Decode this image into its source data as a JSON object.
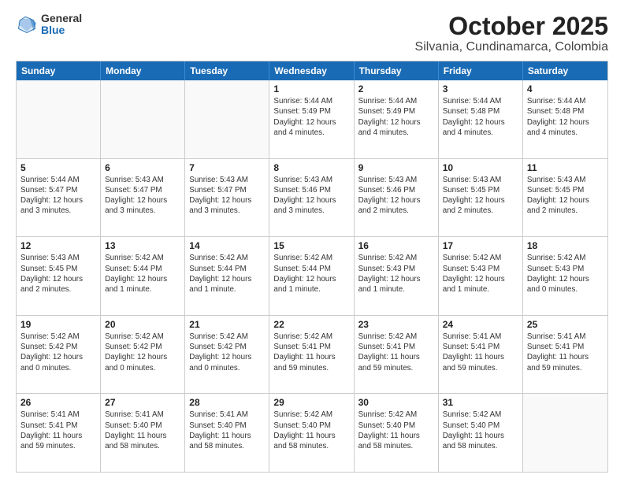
{
  "logo": {
    "general": "General",
    "blue": "Blue"
  },
  "title": "October 2025",
  "subtitle": "Silvania, Cundinamarca, Colombia",
  "days": [
    "Sunday",
    "Monday",
    "Tuesday",
    "Wednesday",
    "Thursday",
    "Friday",
    "Saturday"
  ],
  "weeks": [
    [
      {
        "day": "",
        "text": "",
        "empty": true
      },
      {
        "day": "",
        "text": "",
        "empty": true
      },
      {
        "day": "",
        "text": "",
        "empty": true
      },
      {
        "day": "1",
        "text": "Sunrise: 5:44 AM\nSunset: 5:49 PM\nDaylight: 12 hours\nand 4 minutes.",
        "empty": false
      },
      {
        "day": "2",
        "text": "Sunrise: 5:44 AM\nSunset: 5:49 PM\nDaylight: 12 hours\nand 4 minutes.",
        "empty": false
      },
      {
        "day": "3",
        "text": "Sunrise: 5:44 AM\nSunset: 5:48 PM\nDaylight: 12 hours\nand 4 minutes.",
        "empty": false
      },
      {
        "day": "4",
        "text": "Sunrise: 5:44 AM\nSunset: 5:48 PM\nDaylight: 12 hours\nand 4 minutes.",
        "empty": false
      }
    ],
    [
      {
        "day": "5",
        "text": "Sunrise: 5:44 AM\nSunset: 5:47 PM\nDaylight: 12 hours\nand 3 minutes.",
        "empty": false
      },
      {
        "day": "6",
        "text": "Sunrise: 5:43 AM\nSunset: 5:47 PM\nDaylight: 12 hours\nand 3 minutes.",
        "empty": false
      },
      {
        "day": "7",
        "text": "Sunrise: 5:43 AM\nSunset: 5:47 PM\nDaylight: 12 hours\nand 3 minutes.",
        "empty": false
      },
      {
        "day": "8",
        "text": "Sunrise: 5:43 AM\nSunset: 5:46 PM\nDaylight: 12 hours\nand 3 minutes.",
        "empty": false
      },
      {
        "day": "9",
        "text": "Sunrise: 5:43 AM\nSunset: 5:46 PM\nDaylight: 12 hours\nand 2 minutes.",
        "empty": false
      },
      {
        "day": "10",
        "text": "Sunrise: 5:43 AM\nSunset: 5:45 PM\nDaylight: 12 hours\nand 2 minutes.",
        "empty": false
      },
      {
        "day": "11",
        "text": "Sunrise: 5:43 AM\nSunset: 5:45 PM\nDaylight: 12 hours\nand 2 minutes.",
        "empty": false
      }
    ],
    [
      {
        "day": "12",
        "text": "Sunrise: 5:43 AM\nSunset: 5:45 PM\nDaylight: 12 hours\nand 2 minutes.",
        "empty": false
      },
      {
        "day": "13",
        "text": "Sunrise: 5:42 AM\nSunset: 5:44 PM\nDaylight: 12 hours\nand 1 minute.",
        "empty": false
      },
      {
        "day": "14",
        "text": "Sunrise: 5:42 AM\nSunset: 5:44 PM\nDaylight: 12 hours\nand 1 minute.",
        "empty": false
      },
      {
        "day": "15",
        "text": "Sunrise: 5:42 AM\nSunset: 5:44 PM\nDaylight: 12 hours\nand 1 minute.",
        "empty": false
      },
      {
        "day": "16",
        "text": "Sunrise: 5:42 AM\nSunset: 5:43 PM\nDaylight: 12 hours\nand 1 minute.",
        "empty": false
      },
      {
        "day": "17",
        "text": "Sunrise: 5:42 AM\nSunset: 5:43 PM\nDaylight: 12 hours\nand 1 minute.",
        "empty": false
      },
      {
        "day": "18",
        "text": "Sunrise: 5:42 AM\nSunset: 5:43 PM\nDaylight: 12 hours\nand 0 minutes.",
        "empty": false
      }
    ],
    [
      {
        "day": "19",
        "text": "Sunrise: 5:42 AM\nSunset: 5:42 PM\nDaylight: 12 hours\nand 0 minutes.",
        "empty": false
      },
      {
        "day": "20",
        "text": "Sunrise: 5:42 AM\nSunset: 5:42 PM\nDaylight: 12 hours\nand 0 minutes.",
        "empty": false
      },
      {
        "day": "21",
        "text": "Sunrise: 5:42 AM\nSunset: 5:42 PM\nDaylight: 12 hours\nand 0 minutes.",
        "empty": false
      },
      {
        "day": "22",
        "text": "Sunrise: 5:42 AM\nSunset: 5:41 PM\nDaylight: 11 hours\nand 59 minutes.",
        "empty": false
      },
      {
        "day": "23",
        "text": "Sunrise: 5:42 AM\nSunset: 5:41 PM\nDaylight: 11 hours\nand 59 minutes.",
        "empty": false
      },
      {
        "day": "24",
        "text": "Sunrise: 5:41 AM\nSunset: 5:41 PM\nDaylight: 11 hours\nand 59 minutes.",
        "empty": false
      },
      {
        "day": "25",
        "text": "Sunrise: 5:41 AM\nSunset: 5:41 PM\nDaylight: 11 hours\nand 59 minutes.",
        "empty": false
      }
    ],
    [
      {
        "day": "26",
        "text": "Sunrise: 5:41 AM\nSunset: 5:41 PM\nDaylight: 11 hours\nand 59 minutes.",
        "empty": false
      },
      {
        "day": "27",
        "text": "Sunrise: 5:41 AM\nSunset: 5:40 PM\nDaylight: 11 hours\nand 58 minutes.",
        "empty": false
      },
      {
        "day": "28",
        "text": "Sunrise: 5:41 AM\nSunset: 5:40 PM\nDaylight: 11 hours\nand 58 minutes.",
        "empty": false
      },
      {
        "day": "29",
        "text": "Sunrise: 5:42 AM\nSunset: 5:40 PM\nDaylight: 11 hours\nand 58 minutes.",
        "empty": false
      },
      {
        "day": "30",
        "text": "Sunrise: 5:42 AM\nSunset: 5:40 PM\nDaylight: 11 hours\nand 58 minutes.",
        "empty": false
      },
      {
        "day": "31",
        "text": "Sunrise: 5:42 AM\nSunset: 5:40 PM\nDaylight: 11 hours\nand 58 minutes.",
        "empty": false
      },
      {
        "day": "",
        "text": "",
        "empty": true
      }
    ]
  ]
}
